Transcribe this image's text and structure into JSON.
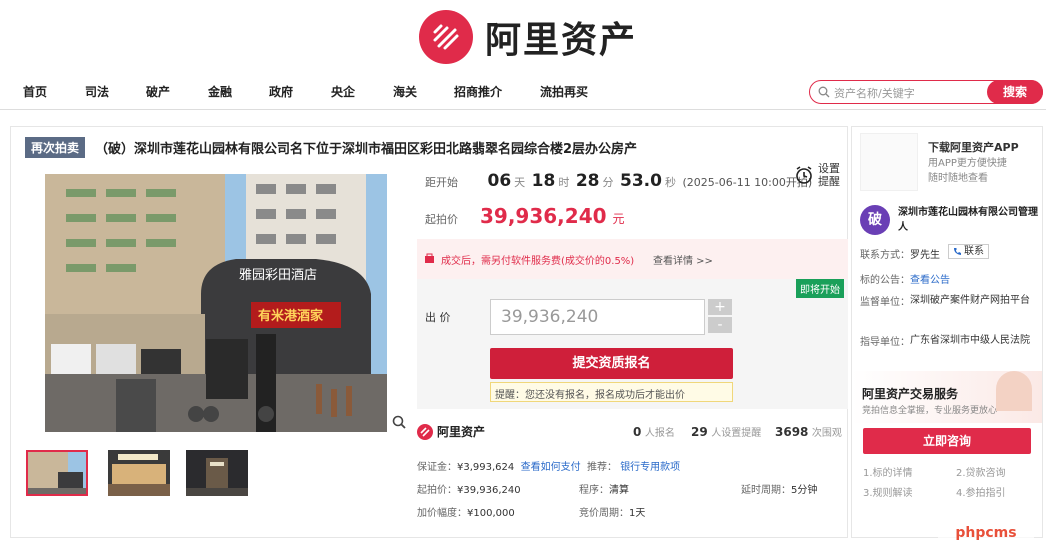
{
  "brand": {
    "name": "阿里资产",
    "color": "#e02b4a"
  },
  "nav": [
    "首页",
    "司法",
    "破产",
    "金融",
    "政府",
    "央企",
    "海关",
    "招商推介",
    "流拍再买"
  ],
  "search": {
    "placeholder": "资产名称/关键字",
    "button": "搜索"
  },
  "listing": {
    "badge": "再次拍卖",
    "title": "（破）深圳市莲花山园林有限公司名下位于深圳市福田区彩田北路翡翠名园综合楼2层办公房产",
    "countdown": {
      "label": "距开始",
      "days": "06",
      "d_unit": "天",
      "hours": "18",
      "h_unit": "时",
      "minutes": "28",
      "m_unit": "分",
      "seconds": "53.0",
      "s_unit": "秒",
      "time": "(2025-06-11 10:00开拍)"
    },
    "reminder": "设置\n提醒",
    "start_label": "起拍价",
    "start_price": "39,936,240",
    "price_unit": "元",
    "fee_note": "成交后，需另付软件服务费(成交价的0.5%)",
    "fee_link": "查看详情 >>",
    "ribbon": "即将开始",
    "bid_label": "出 价",
    "bid_value": "39,936,240",
    "plus": "+",
    "minus": "-",
    "cta": "提交资质报名",
    "tip": "提醒：您还没有报名，报名成功后才能出价",
    "stats": [
      {
        "n": "0",
        "t": "人报名"
      },
      {
        "n": "29",
        "t": "人设置提醒"
      },
      {
        "n": "3698",
        "t": "次围观"
      }
    ],
    "details": {
      "deposit_label": "保证金：",
      "deposit": "¥3,993,624",
      "deposit_link": "查看如何支付",
      "rec_label": "推荐：",
      "rec": "银行专用款项",
      "start_label": "起拍价：",
      "start": "¥39,936,240",
      "proc_label": "程序：",
      "proc": "清算",
      "delay_label": "延时周期：",
      "delay": "5分钟",
      "inc_label": "加价幅度：",
      "inc": "¥100,000",
      "cycle_label": "竞价周期：",
      "cycle": "1天"
    },
    "sign_text": "雅园彩田酒店",
    "shop_sign": "有米港酒家"
  },
  "sidebar": {
    "app_title": "下载阿里资产APP",
    "app_desc": "用APP更方便快捷\n随时随地查看",
    "admin_icon": "破",
    "admin_name": "深圳市莲花山园林有限公司管理人",
    "contact_label": "联系方式：",
    "contact": "罗先生",
    "contact_btn": "联系",
    "notice_label": "标的公告：",
    "notice": "查看公告",
    "supervisor_label": "监督单位：",
    "supervisor": "深圳破产案件财产网拍平台",
    "guide_label": "指导单位：",
    "guide": "广东省深圳市中级人民法院",
    "svc_title": "阿里资产交易服务",
    "svc_desc": "竞拍信息全掌握，专业服务更放心",
    "consult": "立即咨询",
    "links": [
      "1.标的详情",
      "2.贷款咨询",
      "3.规则解读",
      "4.参拍指引"
    ]
  },
  "watermark": "phpcms"
}
